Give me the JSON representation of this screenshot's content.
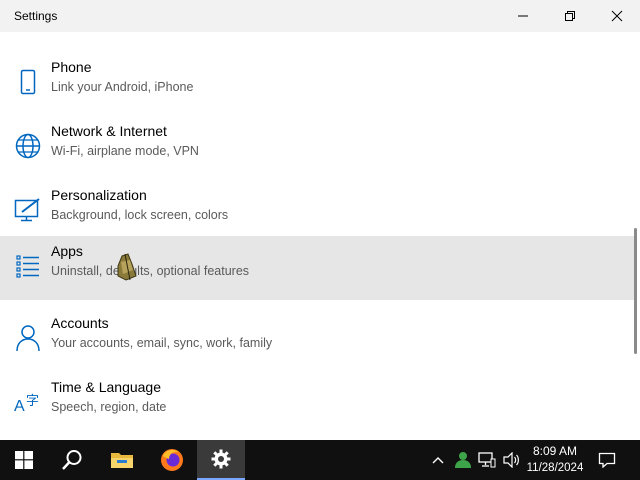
{
  "window": {
    "title": "Settings"
  },
  "items": [
    {
      "label": "Phone",
      "desc": "Link your Android, iPhone",
      "icon": "phone-icon"
    },
    {
      "label": "Network & Internet",
      "desc": "Wi-Fi, airplane mode, VPN",
      "icon": "globe-icon"
    },
    {
      "label": "Personalization",
      "desc": "Background, lock screen, colors",
      "icon": "personalization-icon"
    },
    {
      "label": "Apps",
      "desc": "Uninstall, defaults, optional features",
      "icon": "apps-list-icon",
      "selected": true
    },
    {
      "label": "Accounts",
      "desc": "Your accounts, email, sync, work, family",
      "icon": "person-icon"
    },
    {
      "label": "Time & Language",
      "desc": "Speech, region, date",
      "icon": "time-language-icon"
    }
  ],
  "taskbar": {
    "apps": [
      "windows-start-icon",
      "search-icon",
      "file-explorer-icon",
      "firefox-icon",
      "settings-gear-icon"
    ],
    "clock": {
      "time": "8:09 AM",
      "date": "11/28/2024"
    }
  },
  "colors": {
    "accent": "#0067c0",
    "selected_bg": "#e6e6e6",
    "taskbar": "#101010"
  }
}
